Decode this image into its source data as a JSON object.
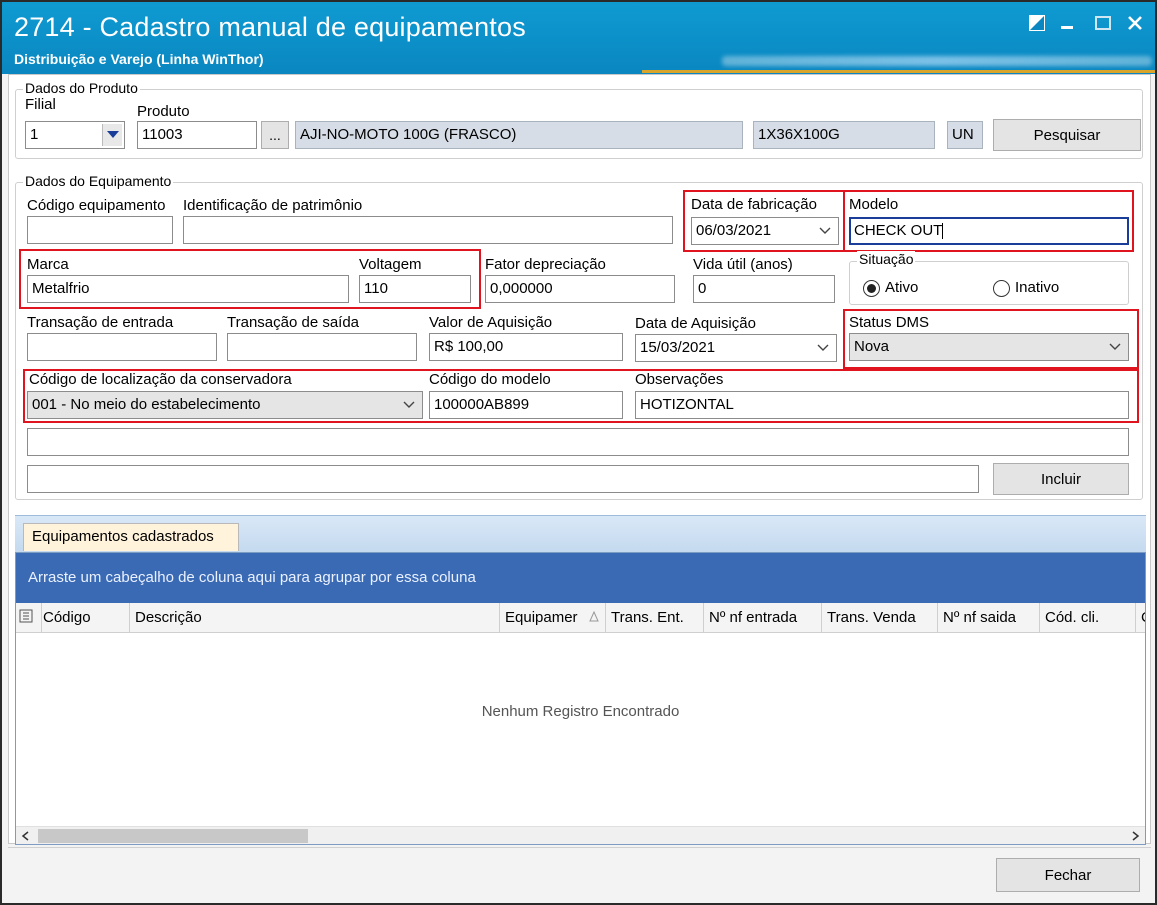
{
  "window": {
    "title": "2714 - Cadastro manual de equipamentos",
    "subtitle": "Distribuição e Varejo (Linha WinThor)",
    "title_bar_color": "#0f9bd2"
  },
  "produto": {
    "group_title": "Dados do Produto",
    "filial_label": "Filial",
    "filial_value": "1",
    "produto_label": "Produto",
    "produto_value": "11003",
    "ellipsis": "...",
    "descricao": "AJI-NO-MOTO 100G (FRASCO)",
    "embalagem": "1X36X100G",
    "unidade": "UN",
    "pesquisar_label": "Pesquisar"
  },
  "equipamento": {
    "group_title": "Dados do Equipamento",
    "codigo_label": "Código equipamento",
    "codigo_value": "",
    "patrimonio_label": "Identificação de patrimônio",
    "patrimonio_value": "",
    "data_fab_label": "Data de fabricação",
    "data_fab_value": "06/03/2021",
    "modelo_label": "Modelo",
    "modelo_value": "CHECK OUT",
    "marca_label": "Marca",
    "marca_value": "Metalfrio",
    "voltagem_label": "Voltagem",
    "voltagem_value": "110",
    "fator_label": "Fator depreciação",
    "fator_value": "0,000000",
    "vida_label": "Vida útil (anos)",
    "vida_value": "0",
    "situacao_label": "Situação",
    "ativo_label": "Ativo",
    "inativo_label": "Inativo",
    "trans_ent_label": "Transação de entrada",
    "trans_ent_value": "",
    "trans_sai_label": "Transação de saída",
    "trans_sai_value": "",
    "valor_aq_label": "Valor de Aquisição",
    "valor_aq_value": "R$ 100,00",
    "data_aq_label": "Data de Aquisição",
    "data_aq_value": "15/03/2021",
    "status_label": "Status DMS",
    "status_value": "Nova",
    "loc_label": "Código de localização da conservadora",
    "loc_value": "001 - No meio do estabelecimento",
    "cod_modelo_label": "Código do modelo",
    "cod_modelo_value": "100000AB899",
    "obs_label": "Observações",
    "obs_value": "HOTIZONTAL",
    "extra1_value": "",
    "extra2_value": "",
    "incluir_label": "Incluir"
  },
  "grid": {
    "tab_label": "Equipamentos cadastrados",
    "group_hint": "Arraste um cabeçalho de coluna aqui para agrupar por essa coluna",
    "columns": [
      "Código",
      "Descrição",
      "Equipamer",
      "Trans. Ent.",
      "Nº nf entrada",
      "Trans. Venda",
      "Nº nf saida",
      "Cód. cli.",
      "C"
    ],
    "empty_text": "Nenhum Registro Encontrado"
  },
  "footer": {
    "fechar_label": "Fechar"
  },
  "colors": {
    "highlight": "#e0141e",
    "group_panel": "#3b6ab4",
    "tab_bg": "#fff3dc"
  }
}
